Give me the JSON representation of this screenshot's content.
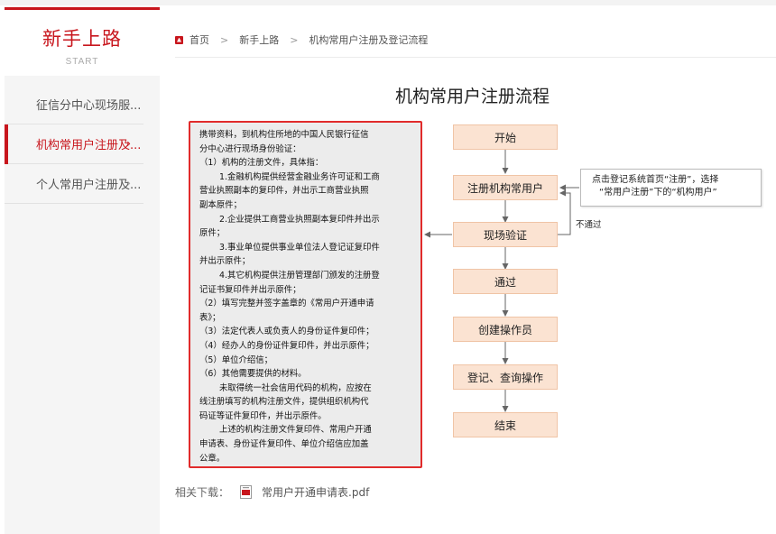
{
  "sidebar": {
    "title": "新手上路",
    "subtitle": "START",
    "items": [
      {
        "label": "征信分中心现场服..."
      },
      {
        "label": "机构常用户注册及..."
      },
      {
        "label": "个人常用户注册及..."
      }
    ],
    "active_index": 1
  },
  "breadcrumb": {
    "home": "首页",
    "items": [
      "新手上路",
      "机构常用户注册及登记流程"
    ],
    "separator": ">"
  },
  "page": {
    "title": "机构常用户注册流程"
  },
  "requirements": {
    "lines": [
      {
        "text": "携带资料，到机构住所地的中国人民银行征信",
        "indent": false
      },
      {
        "text": "分中心进行现场身份验证：",
        "indent": false
      },
      {
        "text": "（1）机构的注册文件，具体指：",
        "indent": false
      },
      {
        "text": "1.金融机构提供经营金融业务许可证和工商",
        "indent": true
      },
      {
        "text": "营业执照副本的复印件，并出示工商营业执照",
        "indent": false
      },
      {
        "text": "副本原件；",
        "indent": false
      },
      {
        "text": "2.企业提供工商营业执照副本复印件并出示",
        "indent": true
      },
      {
        "text": "原件；",
        "indent": false
      },
      {
        "text": "3.事业单位提供事业单位法人登记证复印件",
        "indent": true
      },
      {
        "text": "并出示原件；",
        "indent": false
      },
      {
        "text": "4.其它机构提供注册管理部门颁发的注册登",
        "indent": true
      },
      {
        "text": "记证书复印件并出示原件；",
        "indent": false
      },
      {
        "text": "（2）填写完整并签字盖章的《常用户开通申请",
        "indent": false
      },
      {
        "text": "表》；",
        "indent": false
      },
      {
        "text": "（3）法定代表人或负责人的身份证件复印件；",
        "indent": false
      },
      {
        "text": "（4）经办人的身份证件复印件，并出示原件；",
        "indent": false
      },
      {
        "text": "（5）单位介绍信；",
        "indent": false
      },
      {
        "text": "（6）其他需要提供的材料。",
        "indent": false
      },
      {
        "text": "未取得统一社会信用代码的机构，应按在",
        "indent": true
      },
      {
        "text": "线注册填写的机构注册文件，提供组织机构代",
        "indent": false
      },
      {
        "text": "码证等证件复印件，并出示原件。",
        "indent": false
      },
      {
        "text": "上述的机构注册文件复印件、常用户开通",
        "indent": true
      },
      {
        "text": "申请表、身份证件复印件、单位介绍信应加盖",
        "indent": false
      },
      {
        "text": "公章。",
        "indent": false
      }
    ]
  },
  "flow": {
    "nodes": {
      "start": "开始",
      "register": "注册机构常用户",
      "verify": "现场验证",
      "pass": "通过",
      "operator": "创建操作员",
      "ops": "登记、查询操作",
      "end": "结束"
    },
    "note_lines": [
      "点击登记系统首页“注册”，选择",
      "“常用户注册”下的“机构用户”"
    ],
    "fail_label": "不通过"
  },
  "downloads": {
    "label": "相关下载：",
    "file": "常用户开通申请表.pdf",
    "icon": "pdf-icon"
  },
  "colors": {
    "accent": "#c8161d",
    "highlight_border": "#e12b2b",
    "flow_fill": "#fbe3d2"
  }
}
